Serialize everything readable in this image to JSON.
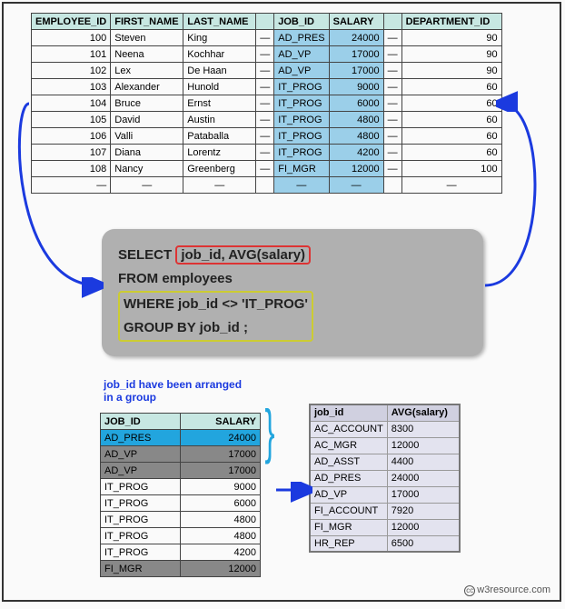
{
  "top_table": {
    "headers": [
      "EMPLOYEE_ID",
      "FIRST_NAME",
      "LAST_NAME",
      "",
      "JOB_ID",
      "SALARY",
      "",
      "DEPARTMENT_ID"
    ],
    "rows": [
      {
        "id": "100",
        "fn": "Steven",
        "ln": "King",
        "job": "AD_PRES",
        "sal": "24000",
        "dept": "90"
      },
      {
        "id": "101",
        "fn": "Neena",
        "ln": "Kochhar",
        "job": "AD_VP",
        "sal": "17000",
        "dept": "90"
      },
      {
        "id": "102",
        "fn": "Lex",
        "ln": "De Haan",
        "job": "AD_VP",
        "sal": "17000",
        "dept": "90"
      },
      {
        "id": "103",
        "fn": "Alexander",
        "ln": "Hunold",
        "job": "IT_PROG",
        "sal": "9000",
        "dept": "60"
      },
      {
        "id": "104",
        "fn": "Bruce",
        "ln": "Ernst",
        "job": "IT_PROG",
        "sal": "6000",
        "dept": "60"
      },
      {
        "id": "105",
        "fn": "David",
        "ln": "Austin",
        "job": "IT_PROG",
        "sal": "4800",
        "dept": "60"
      },
      {
        "id": "106",
        "fn": "Valli",
        "ln": "Pataballa",
        "job": "IT_PROG",
        "sal": "4800",
        "dept": "60"
      },
      {
        "id": "107",
        "fn": "Diana",
        "ln": "Lorentz",
        "job": "IT_PROG",
        "sal": "4200",
        "dept": "60"
      },
      {
        "id": "108",
        "fn": "Nancy",
        "ln": "Greenberg",
        "job": "FI_MGR",
        "sal": "12000",
        "dept": "100"
      }
    ]
  },
  "sql": {
    "select_kw": "SELECT ",
    "select_cols": "job_id, AVG(salary)",
    "from": "FROM employees",
    "where": "WHERE job_id <> 'IT_PROG'",
    "group": "GROUP BY job_id   ;"
  },
  "caption": "job_id have been arranged\nin a group",
  "grp_table": {
    "headers": [
      "JOB_ID",
      "SALARY"
    ],
    "rows": [
      {
        "job": "AD_PRES",
        "sal": "24000",
        "cls": "blue-row"
      },
      {
        "job": "AD_VP",
        "sal": "17000",
        "cls": "grey-row"
      },
      {
        "job": "AD_VP",
        "sal": "17000",
        "cls": "grey-row"
      },
      {
        "job": "IT_PROG",
        "sal": "9000",
        "cls": ""
      },
      {
        "job": "IT_PROG",
        "sal": "6000",
        "cls": ""
      },
      {
        "job": "IT_PROG",
        "sal": "4800",
        "cls": ""
      },
      {
        "job": "IT_PROG",
        "sal": "4800",
        "cls": ""
      },
      {
        "job": "IT_PROG",
        "sal": "4200",
        "cls": ""
      },
      {
        "job": "FI_MGR",
        "sal": "12000",
        "cls": "grey-row"
      }
    ]
  },
  "res_table": {
    "headers": [
      "job_id",
      "AVG(salary)"
    ],
    "rows": [
      {
        "job": "AC_ACCOUNT",
        "avg": "8300",
        "hl": false
      },
      {
        "job": "AC_MGR",
        "avg": "12000",
        "hl": false
      },
      {
        "job": "AD_ASST",
        "avg": "4400",
        "hl": false
      },
      {
        "job": "AD_PRES",
        "avg": "24000",
        "hl": false
      },
      {
        "job": "AD_VP",
        "avg": "17000",
        "hl": true
      },
      {
        "job": "FI_ACCOUNT",
        "avg": "7920",
        "hl": false
      },
      {
        "job": "FI_MGR",
        "avg": "12000",
        "hl": false
      },
      {
        "job": "HR_REP",
        "avg": "6500",
        "hl": false
      }
    ]
  },
  "footer_text": "w3resource.com",
  "dash": "—"
}
